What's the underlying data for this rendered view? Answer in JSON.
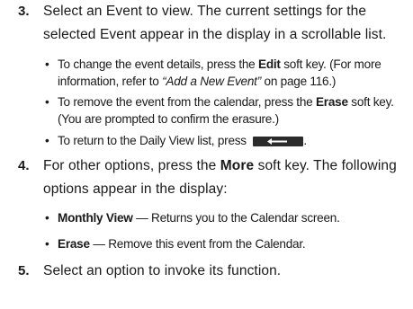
{
  "steps": [
    {
      "number": "3.",
      "text": "Select an Event to view. The current settings for the selected Event appear in the display in a scrollable list.",
      "bullets": [
        {
          "pre": "To change the event details, press the ",
          "bold": "Edit",
          "mid": " soft key. (For more information, refer to ",
          "italic": "“Add a New Event”",
          "post": "  on page 116.)"
        },
        {
          "pre": "To remove the event from the calendar, press the ",
          "bold": "Erase",
          "post": " soft key. (You are prompted to confirm the erasure.)"
        },
        {
          "pre": "To return to the Daily View list, press ",
          "icon": "back-key-icon",
          "post": "."
        }
      ]
    },
    {
      "number": "4.",
      "text_pre": "For other options, press the ",
      "text_bold": "More",
      "text_post": " soft key. The following options appear in the display:",
      "bullets": [
        {
          "bold": "Monthly View",
          "post": " — Returns you to the Calendar screen."
        },
        {
          "bold": "Erase",
          "post": " — Remove this event from the Calendar."
        }
      ]
    },
    {
      "number": "5.",
      "text": "Select an option to invoke its function."
    }
  ],
  "bullet_glyph": "•"
}
